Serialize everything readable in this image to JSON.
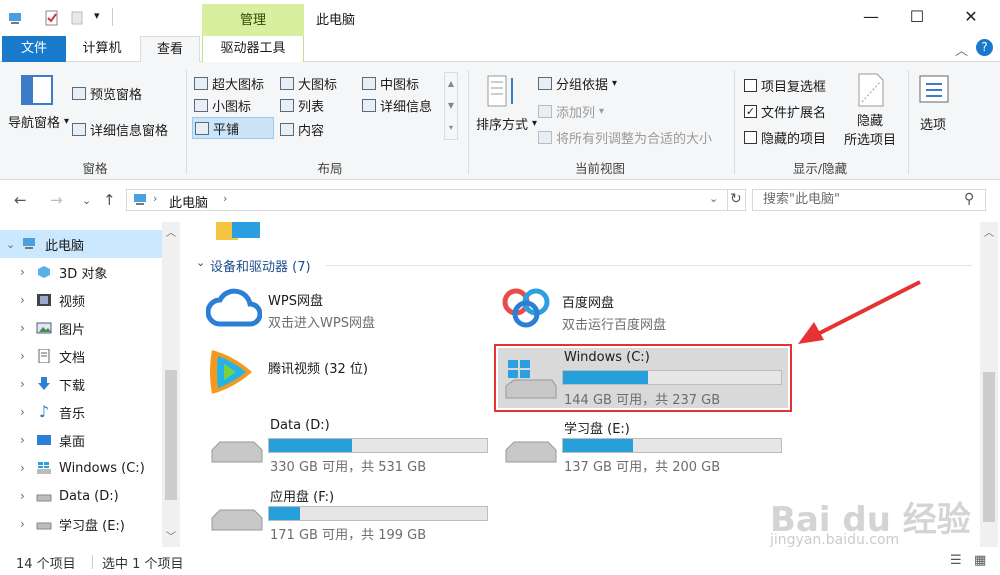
{
  "titlebar": {
    "manage_tab": "管理",
    "window_title": "此电脑",
    "minimize": "—",
    "maximize": "☐",
    "close": "✕"
  },
  "tabs": {
    "file": "文件",
    "computer": "计算机",
    "view": "查看",
    "drive_tools": "驱动器工具"
  },
  "ribbon": {
    "panes": {
      "nav_pane": "导航窗格",
      "preview_pane": "预览窗格",
      "details_pane": "详细信息窗格",
      "label": "窗格"
    },
    "layout": {
      "items": [
        "超大图标",
        "大图标",
        "中图标",
        "小图标",
        "列表",
        "详细信息",
        "平铺",
        "内容"
      ],
      "label": "布局"
    },
    "current_view": {
      "sort": "排序方式",
      "group_by": "分组依据",
      "add_column": "添加列",
      "fit_columns": "将所有列调整为合适的大小",
      "label": "当前视图"
    },
    "show_hide": {
      "item_checkboxes": "项目复选框",
      "file_extensions": "文件扩展名",
      "hidden_items": "隐藏的项目",
      "hide_selected_1": "隐藏",
      "hide_selected_2": "所选项目",
      "label": "显示/隐藏"
    },
    "options": "选项"
  },
  "address": {
    "path": "此电脑",
    "search_placeholder": "搜索\"此电脑\""
  },
  "sidebar": {
    "items": [
      {
        "label": "此电脑"
      },
      {
        "label": "3D 对象"
      },
      {
        "label": "视频"
      },
      {
        "label": "图片"
      },
      {
        "label": "文档"
      },
      {
        "label": "下载"
      },
      {
        "label": "音乐"
      },
      {
        "label": "桌面"
      },
      {
        "label": "Windows (C:)"
      },
      {
        "label": "Data (D:)"
      },
      {
        "label": "学习盘 (E:)"
      }
    ]
  },
  "main": {
    "section_header": "设备和驱动器 (7)",
    "drives": [
      {
        "name": "WPS网盘",
        "sub": "双击进入WPS网盘"
      },
      {
        "name": "百度网盘",
        "sub": "双击运行百度网盘"
      },
      {
        "name": "腾讯视频 (32 位)"
      },
      {
        "name": "Windows (C:)",
        "sub": "144 GB 可用，共 237 GB",
        "used_fraction": 0.39
      },
      {
        "name": "Data (D:)",
        "sub": "330 GB 可用，共 531 GB",
        "used_fraction": 0.38
      },
      {
        "name": "学习盘 (E:)",
        "sub": "137 GB 可用，共 200 GB",
        "used_fraction": 0.32
      },
      {
        "name": "应用盘 (F:)",
        "sub": "171 GB 可用，共 199 GB",
        "used_fraction": 0.14
      }
    ]
  },
  "statusbar": {
    "count": "14 个项目",
    "selected": "选中 1 个项目"
  },
  "watermark": {
    "text": "Bai du 经验",
    "url": "jingyan.baidu.com"
  },
  "colors": {
    "accent": "#1979ca",
    "manage": "#d7ef9f",
    "bar": "#26a0da",
    "highlight": "#e53333"
  }
}
